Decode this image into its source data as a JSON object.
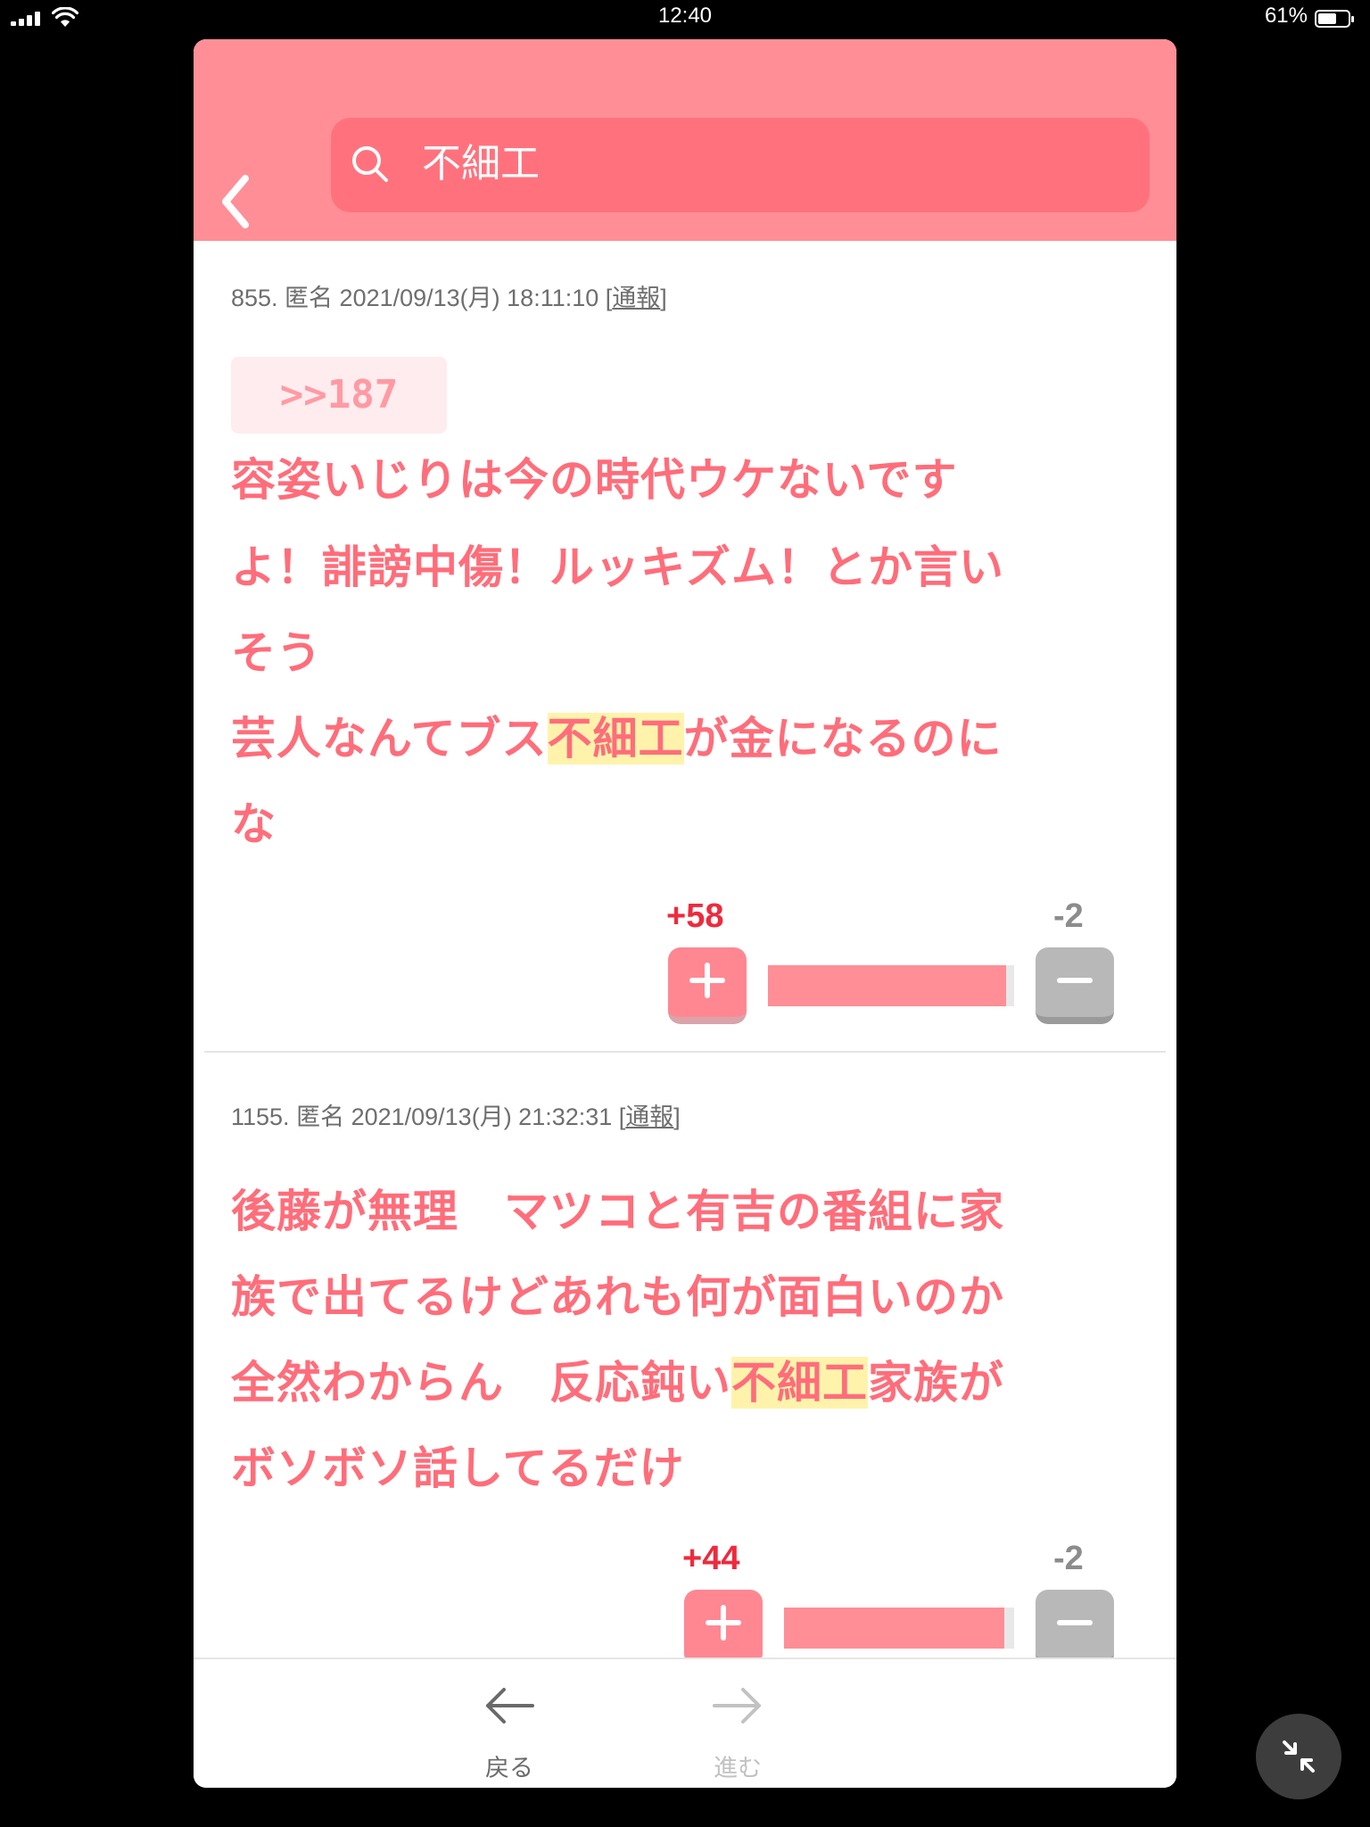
{
  "status_bar": {
    "time": "12:40",
    "battery": "61%",
    "battery_level": 0.61
  },
  "search": {
    "query": "不細工"
  },
  "posts": [
    {
      "meta": {
        "prefix": "855. 匿名 2021/09/13(月) 18:11:10 [",
        "report": "通報",
        "suffix": "]"
      },
      "anchor": ">>187",
      "lines": [
        {
          "text": "容姿いじりは今の時代ウケないです"
        },
        {
          "text": "よ！誹謗中傷！ルッキズム！とか言い"
        },
        {
          "text": "そう"
        },
        {
          "before": "芸人なんてブス",
          "highlight": "不細工",
          "after": "が金になるのに"
        },
        {
          "text": "な"
        }
      ],
      "plus": "+58",
      "minus": "-2",
      "ratio": 0.967
    },
    {
      "meta": {
        "prefix": "1155. 匿名 2021/09/13(月) 21:32:31 [",
        "report": "通報",
        "suffix": "]"
      },
      "lines": [
        {
          "text": "後藤が無理　マツコと有吉の番組に家"
        },
        {
          "text": "族で出てるけどあれも何が面白いのか"
        },
        {
          "before": "全然わからん　反応鈍い",
          "highlight": "不細工",
          "after": "家族が"
        },
        {
          "text": "ボソボソ話してるだけ"
        }
      ],
      "plus": "+44",
      "minus": "-2",
      "ratio": 0.957
    }
  ],
  "toolbar": {
    "back_label": "戻る",
    "forward_label": "進む"
  },
  "colors": {
    "header": "#ff8e96",
    "search_bg": "#ff727d",
    "body_text": "#ff6d7a",
    "highlight": "#fff3ac"
  }
}
